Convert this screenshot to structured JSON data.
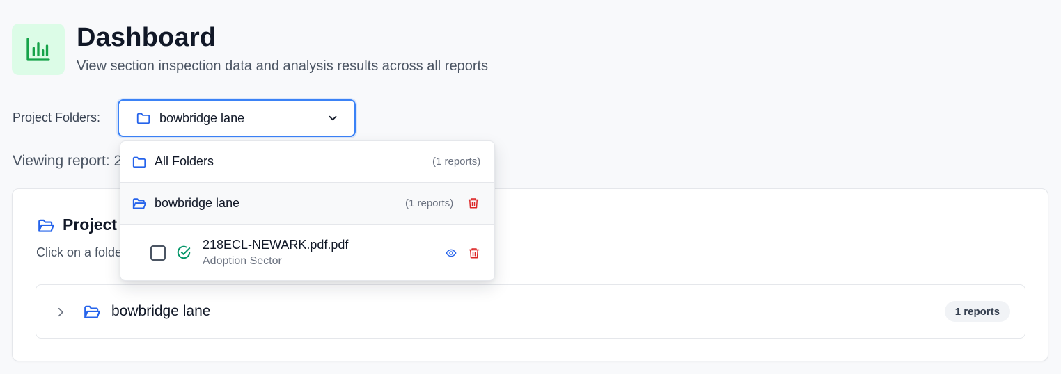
{
  "header": {
    "title": "Dashboard",
    "subtitle": "View section inspection data and analysis results across all reports",
    "icon": "bar-chart-icon",
    "icon_color": "#16a34a",
    "icon_bg": "#dcfce7"
  },
  "folder_select": {
    "label": "Project Folders:",
    "selected": "bowbridge lane",
    "icon": "folder-icon",
    "chevron": "chevron-down-icon",
    "focus_color": "#3b82f6"
  },
  "viewing": {
    "text": "Viewing report: 2"
  },
  "card": {
    "title": "Project",
    "description": "Click on a folde",
    "folder_row": {
      "name": "bowbridge lane",
      "count": "1 reports"
    }
  },
  "dropdown": {
    "all_folders": {
      "label": "All Folders",
      "count": "(1 reports)"
    },
    "folder": {
      "label": "bowbridge lane",
      "count": "(1 reports)"
    },
    "file": {
      "name": "218ECL-NEWARK.pdf.pdf",
      "sector": "Adoption Sector",
      "checked": false,
      "status": "check-circle-icon"
    }
  },
  "colors": {
    "accent": "#2563eb",
    "danger": "#dc2626",
    "success": "#059669"
  }
}
